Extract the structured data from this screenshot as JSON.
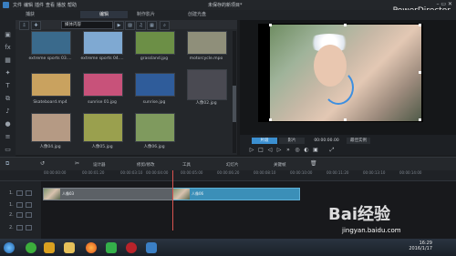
{
  "app": {
    "title": "未保存的新项目*",
    "brand": "PowerDirector",
    "menus": [
      "文件",
      "编辑",
      "插件",
      "查看",
      "播放",
      "帮助"
    ]
  },
  "modes": [
    {
      "label": "捕获",
      "active": false
    },
    {
      "label": "编辑",
      "active": true
    },
    {
      "label": "制作影片",
      "active": false
    },
    {
      "label": "创建光盘",
      "active": false
    }
  ],
  "library": {
    "filter_label": "媒体内容",
    "items": [
      {
        "label": "extreme sports 03....",
        "thumb_color": "#3a6a8c"
      },
      {
        "label": "extreme sports 04....",
        "thumb_color": "#7fa9d2"
      },
      {
        "label": "grassland.jpg",
        "thumb_color": "#6c8f46"
      },
      {
        "label": "motorcycle.mpo",
        "thumb_color": "#8f8f7a"
      },
      {
        "label": "Skateboard.mp4",
        "thumb_color": "#c9a25f"
      },
      {
        "label": "sunrise 01.jpg",
        "thumb_color": "#c8527a"
      },
      {
        "label": "sunrise.jpg",
        "thumb_color": "#2f5c9a"
      },
      {
        "label": "人像02.jpg",
        "thumb_color": "#4a4a52"
      },
      {
        "label": "人像04.jpg",
        "thumb_color": "#b59a84"
      },
      {
        "label": "人像05.jpg",
        "thumb_color": "#9aa04e"
      },
      {
        "label": "人像06.jpg",
        "thumb_color": "#7f9a5e"
      }
    ]
  },
  "preview": {
    "seg_clip": "片段",
    "seg_movie": "影片",
    "timecode": "00:00:00.00",
    "quality": "最佳实例"
  },
  "timeline_toolbar": {
    "items": [
      "设计器",
      "修剪/修改",
      "工具",
      "幻灯片",
      "关键帧"
    ]
  },
  "ruler": {
    "ticks": [
      "00:00:00:00",
      "00:00:01:20",
      "00:00:03:10",
      "00:00:04:00",
      "00:00:05:00",
      "00:00:06:20",
      "00:00:08:10",
      "00:00:10:00",
      "00:00:11:20",
      "00:00:13:10",
      "00:00:14:00"
    ]
  },
  "tracks": [
    {
      "num": "1."
    },
    {
      "num": "1."
    },
    {
      "num": "2."
    },
    {
      "num": "2."
    }
  ],
  "clips": [
    {
      "label": "人像03"
    },
    {
      "label": "人像06"
    }
  ],
  "clock": {
    "time": "16:29",
    "date": "2016/1/17"
  },
  "watermark": {
    "text": "Bai经验",
    "url": "jingyan.baidu.com"
  }
}
